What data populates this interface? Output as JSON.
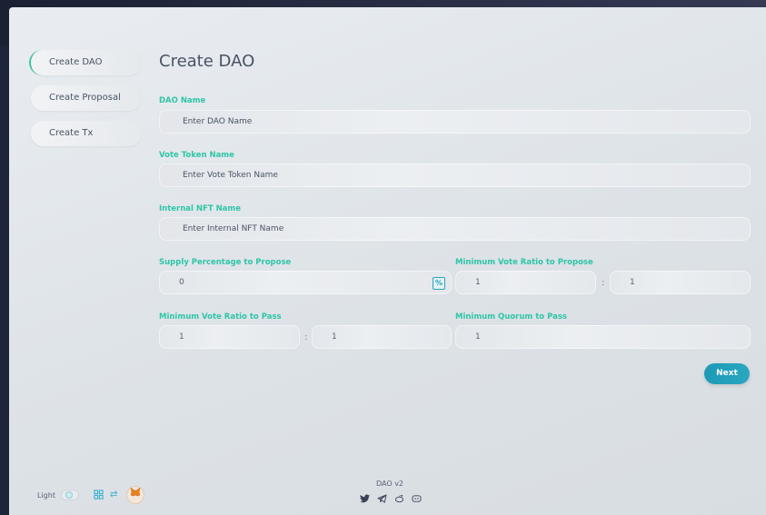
{
  "sidebar": {
    "items": [
      {
        "label": "Create DAO",
        "active": true
      },
      {
        "label": "Create Proposal",
        "active": false
      },
      {
        "label": "Create Tx",
        "active": false
      }
    ]
  },
  "main": {
    "title": "Create DAO",
    "dao_name": {
      "label": "DAO Name",
      "placeholder": "Enter DAO Name"
    },
    "vote_token_name": {
      "label": "Vote Token Name",
      "placeholder": "Enter Vote Token Name"
    },
    "internal_nft_name": {
      "label": "Internal NFT Name",
      "placeholder": "Enter Internal NFT Name"
    },
    "supply_percentage": {
      "label": "Supply Percentage to Propose",
      "value": "0",
      "icon": "percent-icon"
    },
    "min_vote_ratio_propose": {
      "label": "Minimum Vote Ratio to Propose",
      "left_value": "1",
      "separator": ":",
      "right_value": "1"
    },
    "min_vote_ratio_pass": {
      "label": "Minimum Vote Ratio to Pass",
      "left_value": "1",
      "separator": ":",
      "right_value": "1"
    },
    "min_quorum_pass": {
      "label": "Minimum Quorum to Pass",
      "value": "1"
    },
    "next_label": "Next"
  },
  "footer": {
    "version": "DAO v2",
    "socials": [
      "twitter-icon",
      "telegram-icon",
      "reddit-icon",
      "discord-icon"
    ],
    "theme_label": "Light"
  },
  "colors": {
    "accent": "#2fc5a8",
    "button": "#1c9ab6",
    "text": "#4a5366"
  }
}
